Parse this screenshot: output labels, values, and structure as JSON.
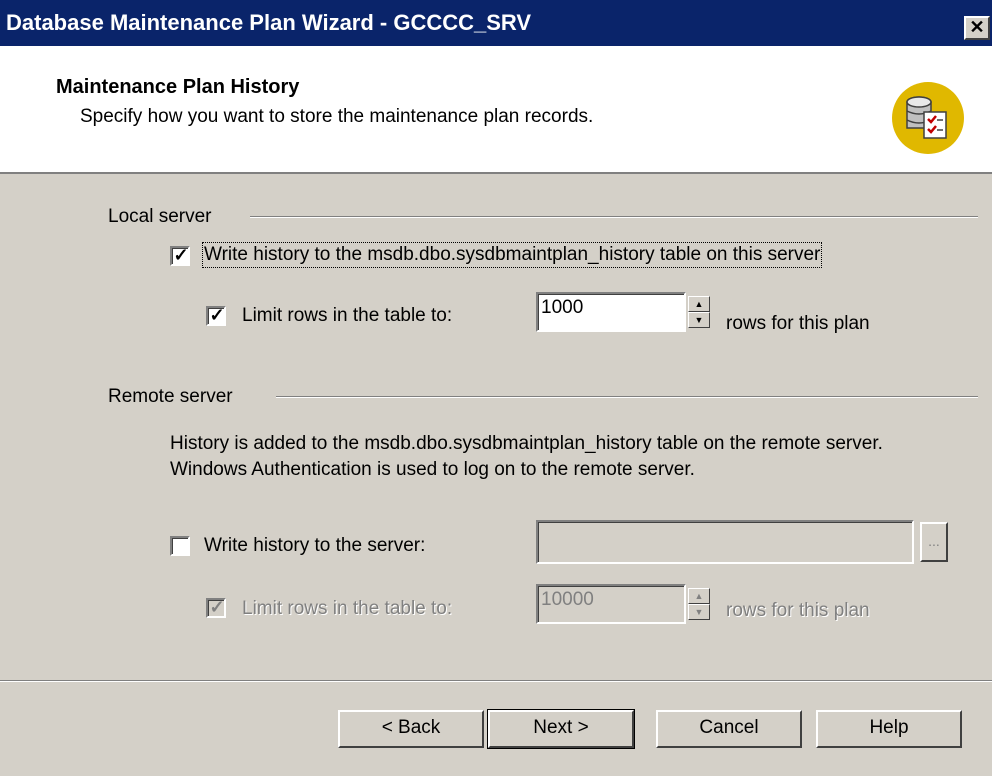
{
  "window": {
    "title": "Database Maintenance Plan Wizard - GCCCC_SRV",
    "close_glyph": "✕"
  },
  "header": {
    "title": "Maintenance Plan History",
    "subtitle": "Specify how you want to store the maintenance plan records.",
    "icon": "database-checklist-icon"
  },
  "local_server": {
    "group_label": "Local server",
    "write_history": {
      "label": "Write history to the msdb.dbo.sysdbmaintplan_history table on this server",
      "checked": true
    },
    "limit_rows": {
      "label": "Limit rows in the table to:",
      "checked": true,
      "value": "1000",
      "suffix": "rows for this plan"
    }
  },
  "remote_server": {
    "group_label": "Remote server",
    "description_line1": "History is added to the msdb.dbo.sysdbmaintplan_history table on the remote server.",
    "description_line2": "Windows Authentication is used to log on to the remote server.",
    "write_history": {
      "label": "Write history to the server:",
      "checked": false,
      "value": ""
    },
    "browse_label": "...",
    "limit_rows": {
      "label": "Limit rows in the table to:",
      "checked": true,
      "disabled": true,
      "value": "10000",
      "suffix": "rows for this plan"
    }
  },
  "buttons": {
    "back": "< Back",
    "next": "Next >",
    "cancel": "Cancel",
    "help": "Help"
  },
  "check_glyph": "✓"
}
